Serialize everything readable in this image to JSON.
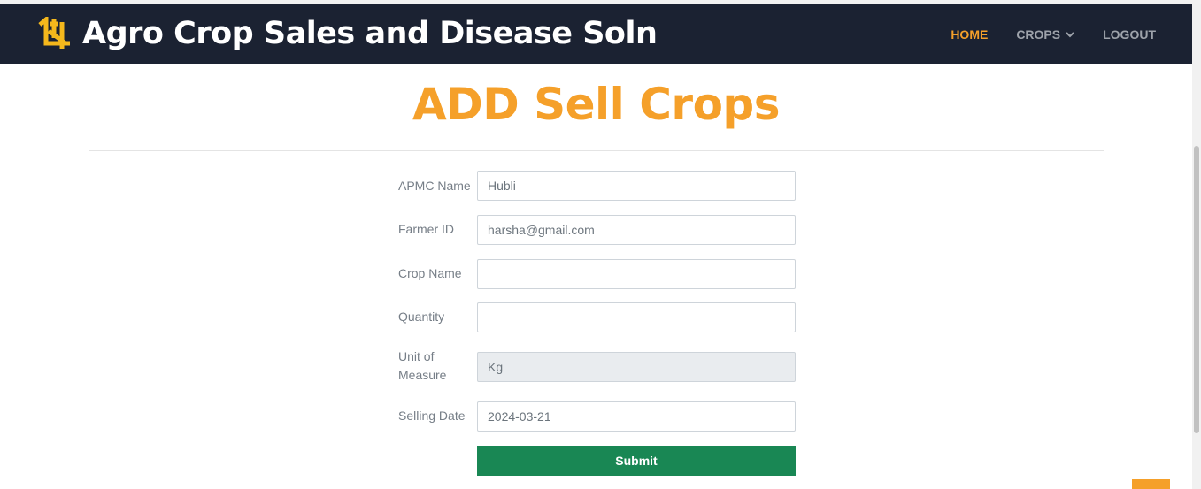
{
  "header": {
    "brand_title": "Agro Crop Sales and Disease Soln",
    "brand_icon": "crop-icon",
    "nav": [
      {
        "label": "HOME",
        "active": true
      },
      {
        "label": "CROPS",
        "active": false,
        "icon": "chevron-down-icon"
      },
      {
        "label": "LOGOUT",
        "active": false
      }
    ]
  },
  "page": {
    "title": "ADD Sell Crops"
  },
  "form": {
    "apmc": {
      "label": "APMC Name",
      "value": "Hubli"
    },
    "farmer": {
      "label": "Farmer ID",
      "value": "harsha@gmail.com"
    },
    "crop": {
      "label": "Crop Name",
      "value": ""
    },
    "quantity": {
      "label": "Quantity",
      "value": ""
    },
    "unit": {
      "label": "Unit of Measure",
      "value": "Kg"
    },
    "date": {
      "label": "Selling Date",
      "value": "2024-03-21"
    },
    "submit_label": "Submit"
  },
  "colors": {
    "navbar": "#1b2232",
    "accent": "#f5a02a",
    "submit": "#198754"
  }
}
